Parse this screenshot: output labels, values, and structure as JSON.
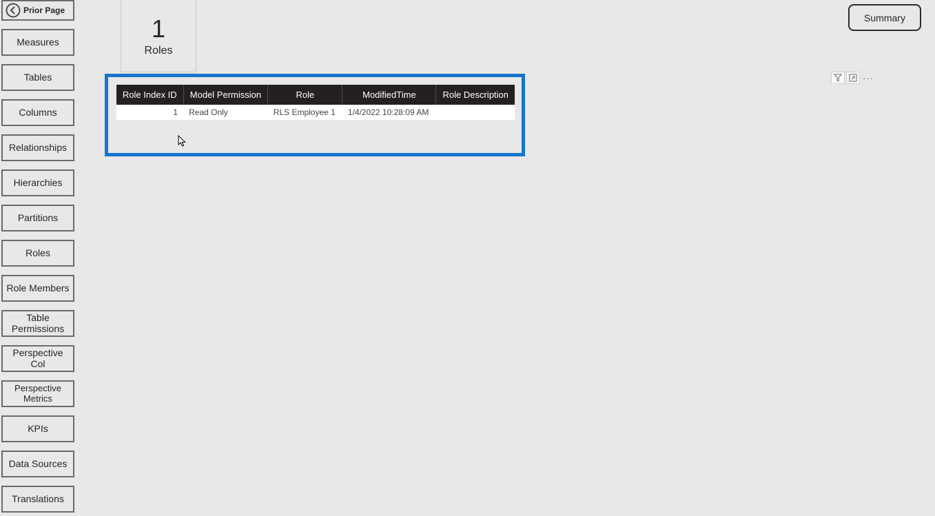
{
  "prior_page_label": "Prior Page",
  "summary_label": "Summary",
  "sidebar_items": [
    "Measures",
    "Tables",
    "Columns",
    "Relationships",
    "Hierarchies",
    "Partitions",
    "Roles",
    "Role Members",
    "Table Permissions",
    "Perspective Col",
    "Perspective Metrics",
    "KPIs",
    "Data Sources",
    "Translations"
  ],
  "card": {
    "value": "1",
    "label": "Roles"
  },
  "table": {
    "headers": [
      "Role Index ID",
      "Model Permission",
      "Role",
      "ModifiedTime",
      "Role Description"
    ],
    "rows": [
      {
        "role_index_id": "1",
        "model_permission": "Read Only",
        "role": "RLS Employee 1",
        "modified_time": "1/4/2022 10:28:09 AM",
        "role_description": ""
      }
    ]
  },
  "icons": {
    "filter": "filter-icon",
    "focus": "focus-mode-icon",
    "more": "more-options-icon"
  }
}
